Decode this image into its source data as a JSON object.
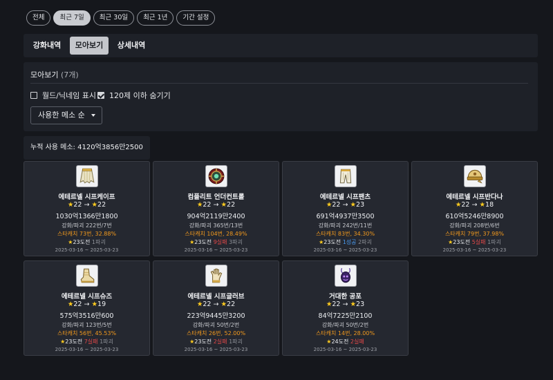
{
  "period_filters": [
    {
      "label": "전체",
      "active": false
    },
    {
      "label": "최근 7일",
      "active": true
    },
    {
      "label": "최근 30일",
      "active": false
    },
    {
      "label": "최근 1년",
      "active": false
    },
    {
      "label": "기간 설정",
      "active": false
    }
  ],
  "tabs": [
    {
      "label": "강화내역",
      "active": false
    },
    {
      "label": "모아보기",
      "active": true
    },
    {
      "label": "상세내역",
      "active": false
    }
  ],
  "panel": {
    "title": "모아보기",
    "count": "(7개)",
    "options": [
      {
        "label": "월드/닉네임 표시",
        "checked": false
      },
      {
        "label": "120제 이하 숨기기",
        "checked": true
      }
    ],
    "sort": {
      "selected": "사용한 메소 순"
    }
  },
  "total": {
    "label": "누적 사용 메소: ",
    "value": "4120억3856만2500"
  },
  "colors": {
    "star": "#ffcc1f",
    "starcatch": "#f39a1d",
    "success": "#4b9bf0",
    "fail": "#e24848",
    "active_tab": "#c5c7cc"
  },
  "items": [
    {
      "name": "에테르넬 시프케이프",
      "icon": "cape-icon",
      "star_from": "22",
      "star_to": "22",
      "meso": "1030억1366만1800",
      "counts": "강화/파괴 222번/7번",
      "starcatch": "스타캐치 73번, 32.88%",
      "attempt": "23도전",
      "success": "",
      "fail": "",
      "destroy": "1파괴",
      "dates": "2025-03-16 ~ 2025-03-23"
    },
    {
      "name": "컴플리트 언더컨트롤",
      "icon": "emblem-icon",
      "star_from": "22",
      "star_to": "22",
      "meso": "904억2119만2400",
      "counts": "강화/파괴 365번/13번",
      "starcatch": "스타캐치 104번, 28.49%",
      "attempt": "23도전",
      "success": "",
      "fail": "9실패",
      "destroy": "3파괴",
      "dates": "2025-03-16 ~ 2025-03-23"
    },
    {
      "name": "에테르넬 시프팬츠",
      "icon": "pants-icon",
      "star_from": "22",
      "star_to": "23",
      "meso": "691억4937만3500",
      "counts": "강화/파괴 242번/11번",
      "starcatch": "스타캐치 83번, 34.30%",
      "attempt": "23도전",
      "success": "1성공",
      "fail": "",
      "destroy": "2파괴",
      "dates": "2025-03-16 ~ 2025-03-23"
    },
    {
      "name": "에테르넬 시프반다나",
      "icon": "bandana-icon",
      "star_from": "22",
      "star_to": "18",
      "meso": "610억5246만8900",
      "counts": "강화/파괴 208번/6번",
      "starcatch": "스타캐치 79번, 37.98%",
      "attempt": "23도전",
      "success": "",
      "fail": "5실패",
      "destroy": "1파괴",
      "dates": "2025-03-16 ~ 2025-03-23"
    },
    {
      "name": "에테르넬 시프슈즈",
      "icon": "shoes-icon",
      "star_from": "22",
      "star_to": "19",
      "meso": "575억3516만600",
      "counts": "강화/파괴 123번/5번",
      "starcatch": "스타캐치 56번, 45.53%",
      "attempt": "23도전",
      "success": "",
      "fail": "7실패",
      "destroy": "1파괴",
      "dates": "2025-03-16 ~ 2025-03-23"
    },
    {
      "name": "에테르넬 시프글러브",
      "icon": "glove-icon",
      "star_from": "22",
      "star_to": "22",
      "meso": "223억9445만3200",
      "counts": "강화/파괴 50번/2번",
      "starcatch": "스타캐치 26번, 52.00%",
      "attempt": "23도전",
      "success": "",
      "fail": "2실패",
      "destroy": "1파괴",
      "dates": "2025-03-16 ~ 2025-03-23"
    },
    {
      "name": "거대한 공포",
      "icon": "pendant-icon",
      "star_from": "22",
      "star_to": "23",
      "meso": "84억7225만2100",
      "counts": "강화/파괴 50번/2번",
      "starcatch": "스타캐치 14번, 28.00%",
      "attempt": "24도전",
      "success": "",
      "fail": "2실패",
      "destroy": "",
      "dates": "2025-03-16 ~ 2025-03-23"
    }
  ]
}
